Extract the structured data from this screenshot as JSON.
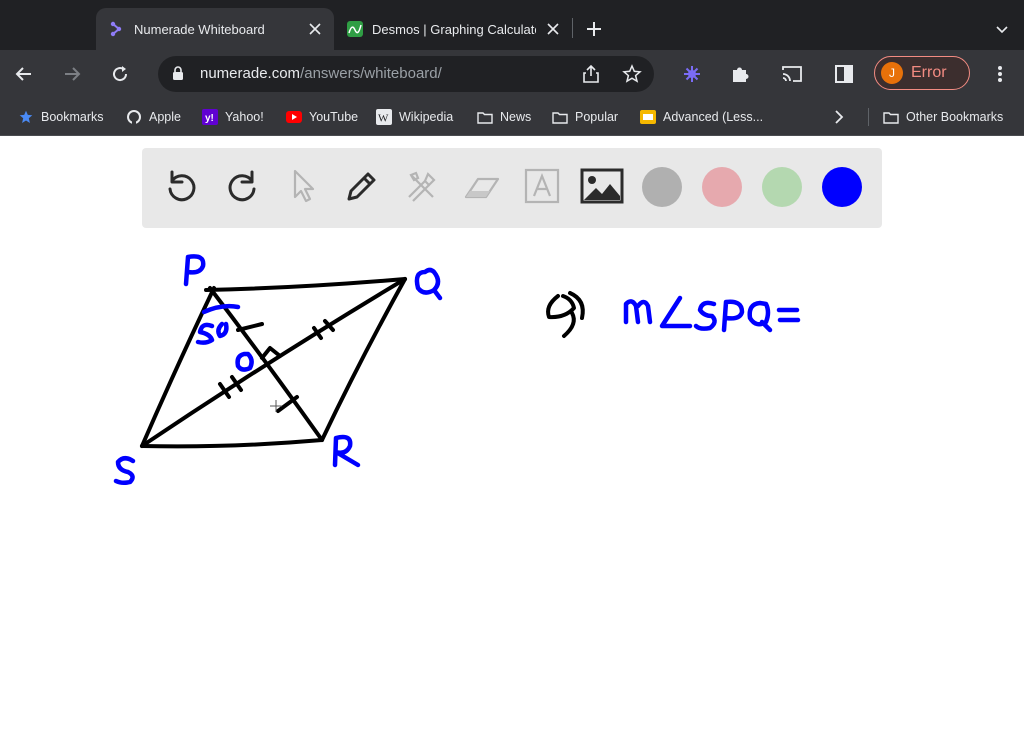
{
  "browser": {
    "tabs": [
      {
        "title": "Numerade Whiteboard",
        "active": true,
        "favicon": "numerade-icon"
      },
      {
        "title": "Desmos | Graphing Calculator",
        "active": false,
        "favicon": "desmos-icon"
      }
    ],
    "url": {
      "host": "numerade.com",
      "path": "/answers/whiteboard/"
    },
    "profile": {
      "initial": "J",
      "status": "Error"
    },
    "bookmarks": [
      {
        "label": "Bookmarks",
        "icon": "star-icon"
      },
      {
        "label": "Apple",
        "icon": "apple-icon"
      },
      {
        "label": "Yahoo!",
        "icon": "yahoo-icon"
      },
      {
        "label": "YouTube",
        "icon": "youtube-icon"
      },
      {
        "label": "Wikipedia",
        "icon": "wikipedia-icon"
      },
      {
        "label": "News",
        "icon": "folder-icon"
      },
      {
        "label": "Popular",
        "icon": "folder-icon"
      },
      {
        "label": "Advanced (Less...",
        "icon": "bookmark-icon"
      }
    ],
    "other_bookmarks": "Other Bookmarks"
  },
  "whiteboard": {
    "tools": [
      "undo-icon",
      "redo-icon",
      "pointer-icon",
      "pen-icon",
      "tools-icon",
      "eraser-icon",
      "text-icon",
      "image-icon"
    ],
    "colors": [
      "#b0b0b0",
      "#e6a9ae",
      "#b4d8b0",
      "#0000ff"
    ],
    "selected_color": "#0000ff"
  },
  "drawing": {
    "vertex_labels": [
      "P",
      "Q",
      "R",
      "S"
    ],
    "center_label": "O",
    "question": "mLSPQ =",
    "ink_color": "#000000",
    "label_color": "#0000ff"
  }
}
